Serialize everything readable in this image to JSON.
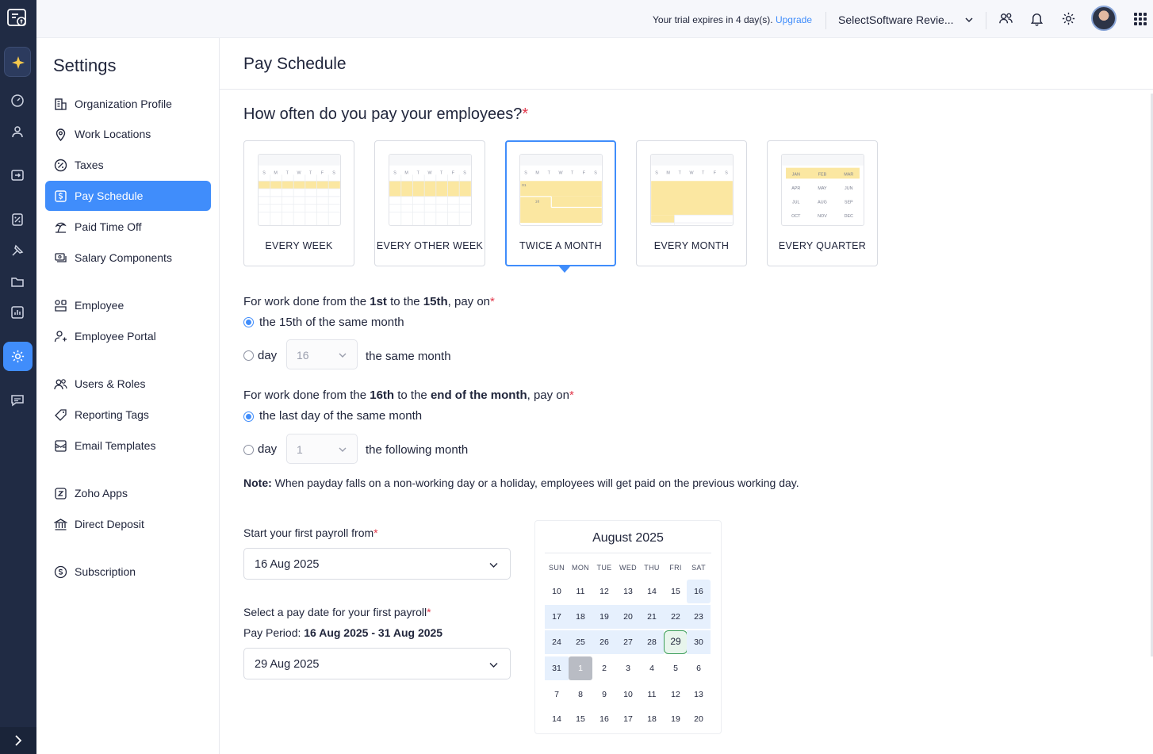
{
  "topbar": {
    "trial_text": "Your trial expires in 4 day(s).",
    "upgrade_label": "Upgrade",
    "org_name": "SelectSoftware Revie..."
  },
  "sidebar": {
    "title": "Settings",
    "items": [
      {
        "label": "Organization Profile",
        "icon": "building-icon"
      },
      {
        "label": "Work Locations",
        "icon": "location-pin-icon"
      },
      {
        "label": "Taxes",
        "icon": "percent-icon"
      },
      {
        "label": "Pay Schedule",
        "icon": "dollar-square-icon",
        "selected": true
      },
      {
        "label": "Paid Time Off",
        "icon": "beach-icon"
      },
      {
        "label": "Salary Components",
        "icon": "salary-components-icon"
      },
      {
        "label": "Employee",
        "icon": "employee-grid-icon"
      },
      {
        "label": "Employee Portal",
        "icon": "employee-portal-icon"
      },
      {
        "label": "Users & Roles",
        "icon": "users-icon"
      },
      {
        "label": "Reporting Tags",
        "icon": "tag-icon"
      },
      {
        "label": "Email Templates",
        "icon": "email-template-icon"
      },
      {
        "label": "Zoho Apps",
        "icon": "zoho-apps-icon"
      },
      {
        "label": "Direct Deposit",
        "icon": "bank-icon"
      },
      {
        "label": "Subscription",
        "icon": "subscription-icon"
      }
    ]
  },
  "main": {
    "page_title": "Pay Schedule",
    "question": "How often do you pay your employees?",
    "required_mark": "*",
    "frequencies": [
      {
        "label": "EVERY WEEK"
      },
      {
        "label": "EVERY OTHER WEEK"
      },
      {
        "label": "TWICE A MONTH",
        "selected": true
      },
      {
        "label": "EVERY MONTH"
      },
      {
        "label": "EVERY QUARTER"
      }
    ],
    "mini_weekdays": [
      "S",
      "M",
      "T",
      "W",
      "T",
      "F",
      "S"
    ],
    "mini_marks": [
      "01",
      "16"
    ],
    "quarter_months": [
      "JAN",
      "FEB",
      "MAR",
      "APR",
      "MAY",
      "JUN",
      "JUL",
      "AUG",
      "SEP",
      "OCT",
      "NOV",
      "DEC"
    ],
    "first_half": {
      "prefix": "For work done from the",
      "b1": "1st",
      "mid": "to the",
      "b2": "15th",
      "suffix": ", pay on",
      "option1": "the 15th of the same month",
      "option2_day": "day",
      "option2_value": "16",
      "option2_after": "the same month"
    },
    "second_half": {
      "prefix": "For work done from the",
      "b1": "16th",
      "mid": "to the",
      "b2": "end of the month",
      "suffix": ", pay on",
      "option1": "the last day of the same month",
      "option2_day": "day",
      "option2_value": "1",
      "option2_after": "the following month"
    },
    "note_label": "Note:",
    "note_text": "When payday falls on a non-working day or a holiday, employees will get paid on the previous working day.",
    "start_label": "Start your first payroll from",
    "start_value": "16 Aug 2025",
    "paydate_label": "Select a pay date for your first payroll",
    "pay_period_label": "Pay Period:",
    "pay_period_value": "16 Aug 2025 - 31 Aug 2025",
    "paydate_value": "29 Aug 2025"
  },
  "calendar": {
    "month": "August 2025",
    "weekdays": [
      "SUN",
      "MON",
      "TUE",
      "WED",
      "THU",
      "FRI",
      "SAT"
    ],
    "weeks": [
      [
        "10",
        "11",
        "12",
        "13",
        "14",
        "15",
        "16"
      ],
      [
        "17",
        "18",
        "19",
        "20",
        "21",
        "22",
        "23"
      ],
      [
        "24",
        "25",
        "26",
        "27",
        "28",
        "29",
        "30"
      ],
      [
        "31",
        "1",
        "2",
        "3",
        "4",
        "5",
        "6"
      ],
      [
        "7",
        "8",
        "9",
        "10",
        "11",
        "12",
        "13"
      ],
      [
        "14",
        "15",
        "16",
        "17",
        "18",
        "19",
        "20"
      ]
    ]
  },
  "colors": {
    "accent": "#408dfb",
    "rail": "#202b44",
    "required": "#e2374a",
    "highlight": "#fbe7a1",
    "selected_day": "#3d9f5b"
  }
}
